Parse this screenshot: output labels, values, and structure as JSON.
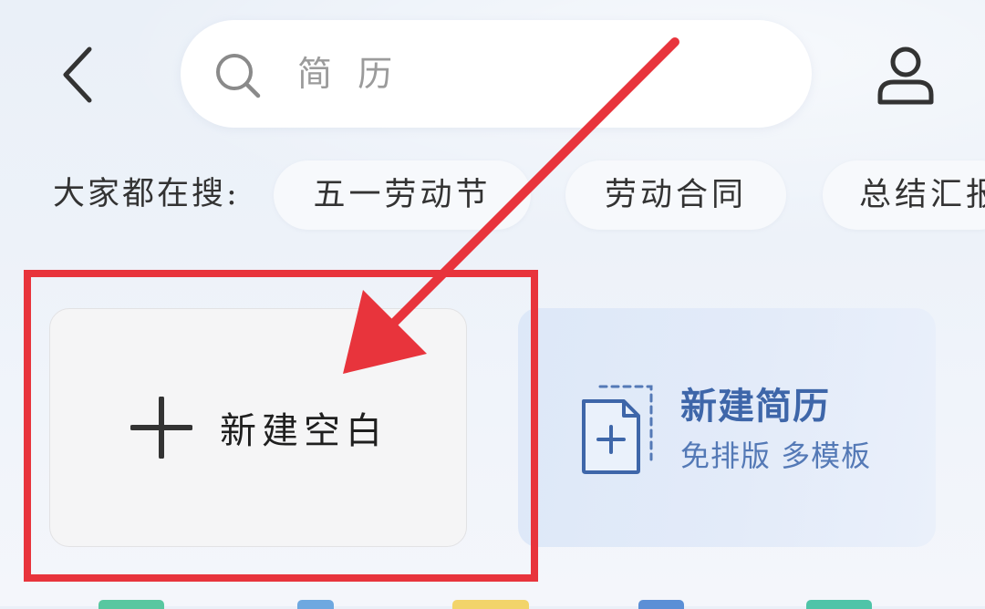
{
  "header": {
    "back_icon": "chevron-left-icon",
    "search": {
      "icon": "search-icon",
      "placeholder": "简 历"
    },
    "user_icon": "user-icon"
  },
  "hot_searches": {
    "label": "大家都在搜:",
    "items": [
      "五一劳动节",
      "劳动合同",
      "总结汇报"
    ]
  },
  "cards": {
    "blank": {
      "icon": "plus-icon",
      "label": "新建空白"
    },
    "resume": {
      "icon": "document-plus-icon",
      "title": "新建简历",
      "subtitle": "免排版 多模板"
    }
  },
  "annotation": {
    "highlight_color": "#e8343c",
    "arrow_color": "#e8343c"
  },
  "colors": {
    "resume_title": "#3e66a9",
    "resume_sub": "#5479b6"
  }
}
